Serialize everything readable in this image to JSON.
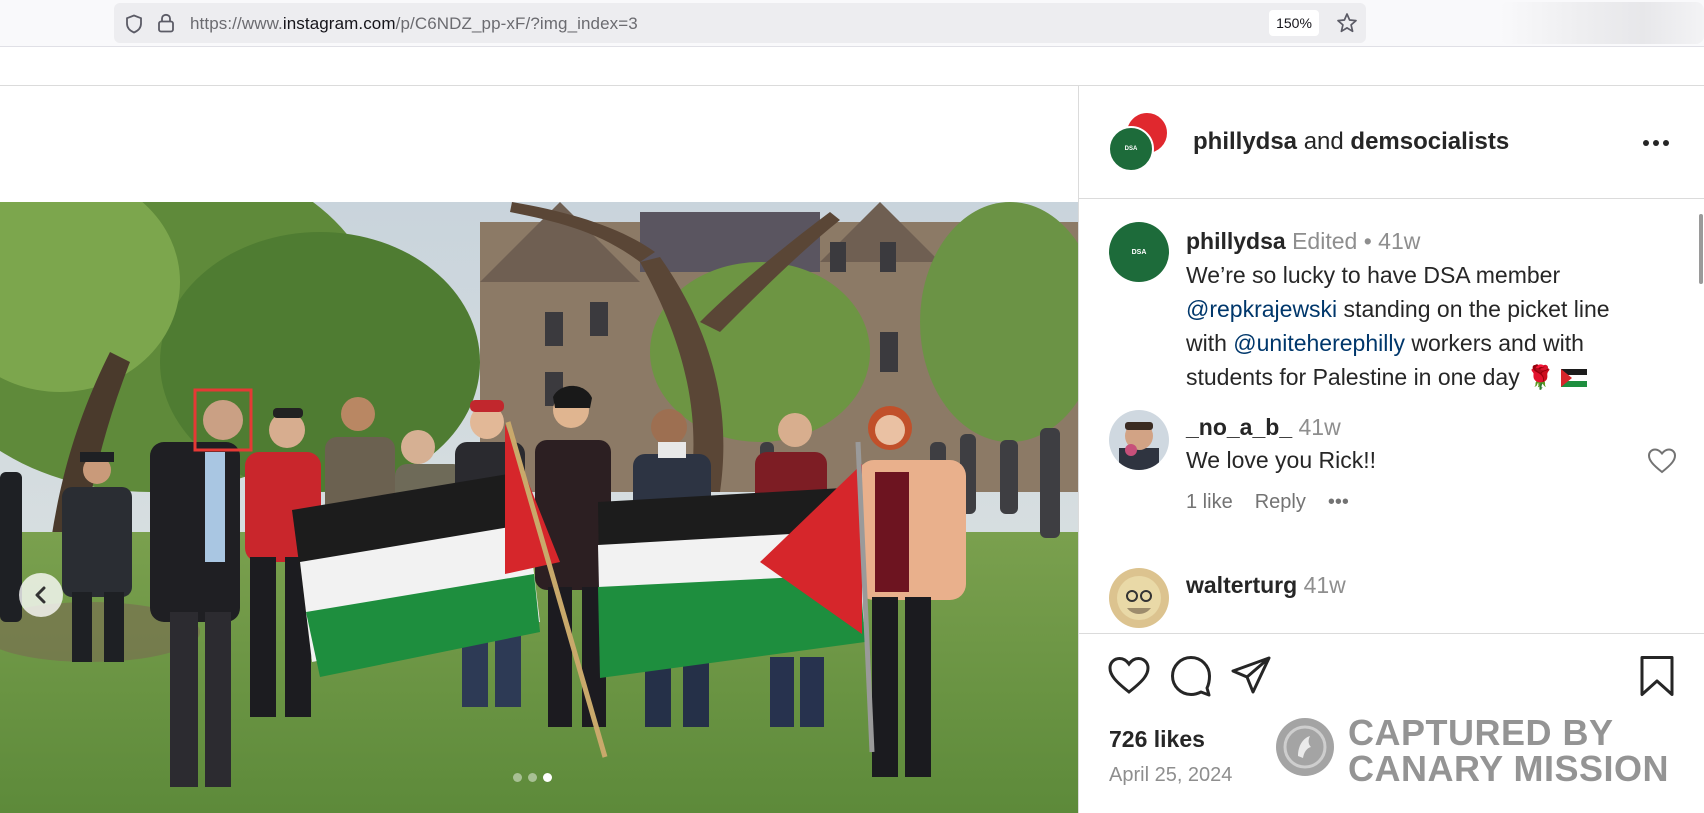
{
  "browser": {
    "url_prefix": "https://www.",
    "url_host": "instagram.com",
    "url_path": "/p/C6NDZ_pp-xF/?img_index=3",
    "zoom": "150%",
    "icons": [
      "shield-icon",
      "lock-icon",
      "star-icon"
    ]
  },
  "post": {
    "header": {
      "user1": "phillydsa",
      "conjunction": "and",
      "user2": "demsocialists"
    },
    "caption": {
      "username": "phillydsa",
      "edited": "Edited",
      "separator": "•",
      "age": "41w",
      "line1": "We’re so lucky to have DSA member",
      "mention1": "@repkrajewski",
      "line2": " standing on the picket line",
      "line3_pre": "with ",
      "mention2": "@uniteherephilly",
      "line3_post": " workers and with",
      "line4": "students for Palestine in one day 🌹"
    },
    "comments": [
      {
        "username": "_no_a_b_",
        "age": "41w",
        "text": "We love you Rick!!",
        "likes": "1 like",
        "reply": "Reply",
        "more": "•••"
      },
      {
        "username": "walterturg",
        "age": "41w"
      }
    ],
    "likes": "726 likes",
    "date": "April 25, 2024",
    "carousel": {
      "current": 3,
      "total": 3
    }
  },
  "watermark": {
    "line1": "CAPTURED BY",
    "line2": "CANARY MISSION"
  },
  "colors": {
    "link": "#00376b",
    "meta": "#8e8e8e",
    "dsa_green": "#1d6b3a",
    "dsa_red": "#e0282e",
    "highlight_box": "#e53935"
  }
}
